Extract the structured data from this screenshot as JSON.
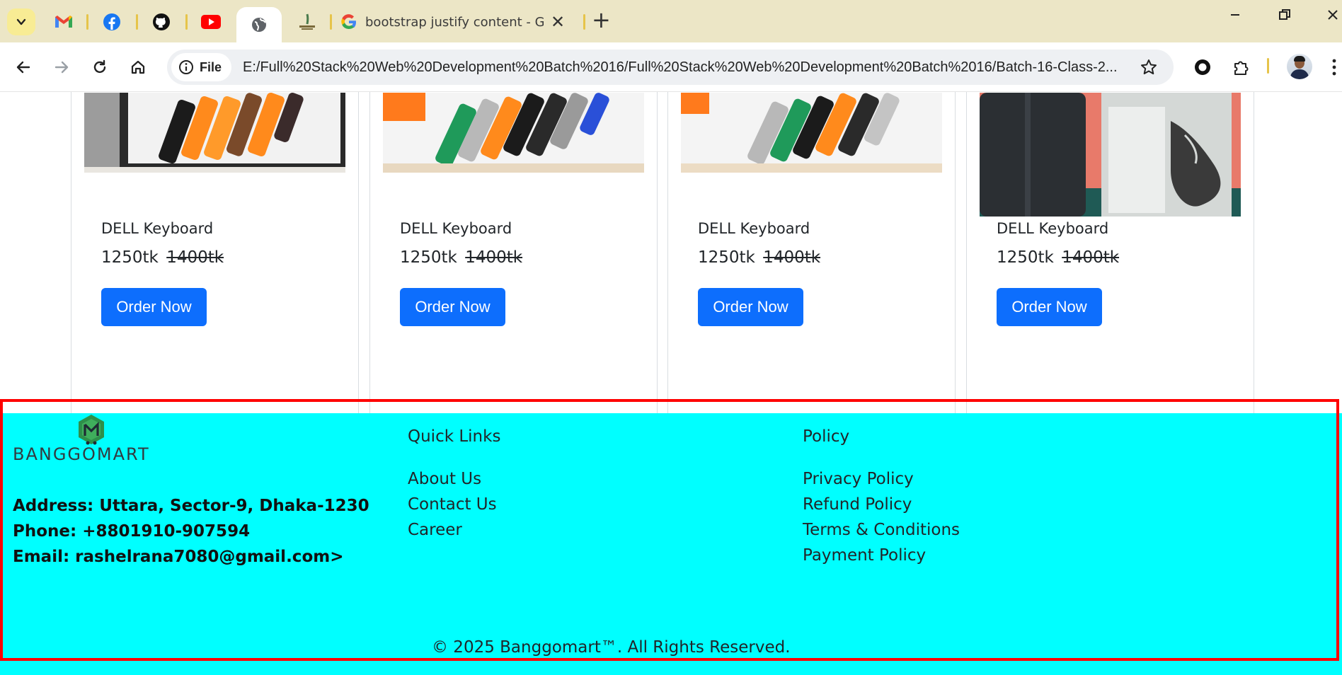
{
  "browser": {
    "active_tab_title": "bootstrap justify content - Goog",
    "site_chip_label": "File",
    "url": "E:/Full%20Stack%20Web%20Development%20Batch%2016/Full%20Stack%20Web%20Development%20Batch%2016/Batch-16-Class-2..."
  },
  "products": [
    {
      "name": "DELL Keyboard",
      "price": "1250tk",
      "old_price": "1400tk",
      "button": "Order Now"
    },
    {
      "name": "DELL Keyboard",
      "price": "1250tk",
      "old_price": "1400tk",
      "button": "Order Now"
    },
    {
      "name": "DELL Keyboard",
      "price": "1250tk",
      "old_price": "1400tk",
      "button": "Order Now"
    },
    {
      "name": "DELL Keyboard",
      "price": "1250tk",
      "old_price": "1400tk",
      "button": "Order Now"
    }
  ],
  "footer": {
    "brand": "BANGGOMART",
    "address": "Address: Uttara, Sector-9, Dhaka-1230",
    "phone": "Phone: +8801910-907594",
    "email": "Email: rashelrana7080@gmail.com>",
    "quick_links": {
      "title": "Quick Links",
      "items": [
        "About Us",
        "Contact Us",
        "Career"
      ]
    },
    "policy": {
      "title": "Policy",
      "items": [
        "Privacy Policy",
        "Refund Policy",
        "Terms & Conditions",
        "Payment Policy"
      ]
    },
    "copyright": "© 2025 Banggomart™. All Rights Reserved."
  },
  "colors": {
    "tabbar_bg": "#ece6c6",
    "primary_button": "#0d6efd",
    "footer_bg": "#00ffff",
    "highlight_outline": "#ff0000"
  }
}
